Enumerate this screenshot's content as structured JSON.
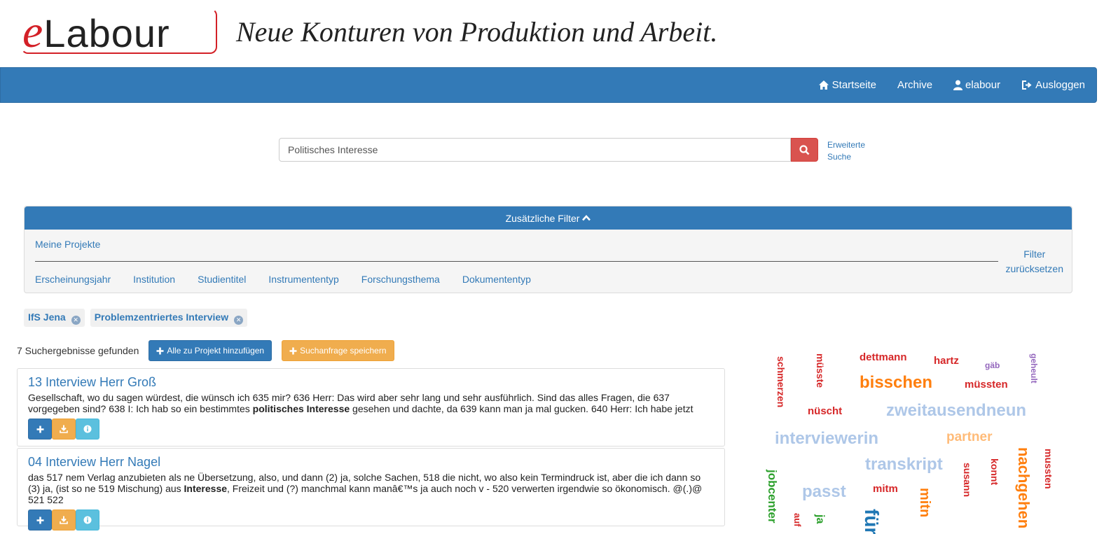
{
  "brand": {
    "logo_e": "e",
    "logo_rest": "Labour",
    "tagline": "Neue Konturen von Produktion und Arbeit."
  },
  "nav": {
    "home": {
      "label": "Startseite",
      "icon": "home-icon"
    },
    "archive": {
      "label": "Archive"
    },
    "user": {
      "label": "elabour",
      "icon": "user-icon"
    },
    "logout": {
      "label": "Ausloggen",
      "icon": "logout-icon"
    }
  },
  "search": {
    "value": "Politisches Interesse",
    "button_icon": "search-icon",
    "advanced_line1": "Erweiterte",
    "advanced_line2": "Suche"
  },
  "filters": {
    "header": "Zusätzliche Filter",
    "my_projects": "Meine Projekte",
    "tabs": [
      "Erscheinungsjahr",
      "Institution",
      "Studientitel",
      "Instrumententyp",
      "Forschungsthema",
      "Dokumententyp"
    ],
    "reset_line1": "Filter",
    "reset_line2": "zurücksetzen"
  },
  "chips": [
    "IfS Jena",
    "Problemzentriertes Interview"
  ],
  "results": {
    "count_text": "7 Suchergebnisse gefunden",
    "add_all": "Alle zu Projekt hinzufügen",
    "save_query": "Suchanfrage speichern",
    "items": [
      {
        "title": "13 Interview Herr Groß",
        "pre": "Gesellschaft, wo du sagen würdest, die wünsch ich 635 mir? 636 Herr: Das wird aber sehr lang und sehr ausführlich. Sind das alles Fragen, die 637 vorgegeben sind? 638 I: Ich hab so ein bestimmtes ",
        "highlight": "politisches Interesse",
        "post": " gesehen und dachte, da 639 kann man ja mal gucken. 640 Herr: Ich habe jetzt"
      },
      {
        "title": "04 Interview Herr Nagel",
        "pre": "das 517 nem Verlag anzubieten als ne Übersetzung, also, und dann (2) ja, solche Sachen, 518 die nicht, wo also kein Termindruck ist, aber die ich dann so (3) ja, (ist so ne 519 Mischung) aus ",
        "highlight": "Interesse",
        "post": ", Freizeit und (?) manchmal kann manâ€™s ja auch noch v - 520 verwerten irgendwie so ökonomisch. @(.)@ 521 522"
      }
    ]
  },
  "word_cloud": [
    {
      "text": "schmerzen",
      "color": "#d62728"
    },
    {
      "text": "müsste",
      "color": "#d62728"
    },
    {
      "text": "dettmann",
      "color": "#d62728"
    },
    {
      "text": "hartz",
      "color": "#d62728"
    },
    {
      "text": "gäb",
      "color": "#9467bd"
    },
    {
      "text": "geheult",
      "color": "#9467bd"
    },
    {
      "text": "bisschen",
      "color": "#ff7f0e"
    },
    {
      "text": "müssten",
      "color": "#d62728"
    },
    {
      "text": "nüscht",
      "color": "#d62728"
    },
    {
      "text": "zweitausendneun",
      "color": "#aec7e8"
    },
    {
      "text": "interviewerin",
      "color": "#aec7e8"
    },
    {
      "text": "partner",
      "color": "#ffbb78"
    },
    {
      "text": "transkript",
      "color": "#aec7e8"
    },
    {
      "text": "susann",
      "color": "#d62728"
    },
    {
      "text": "konnt",
      "color": "#d62728"
    },
    {
      "text": "nachgehen",
      "color": "#ff7f0e"
    },
    {
      "text": "mussten",
      "color": "#d62728"
    },
    {
      "text": "jobcenter",
      "color": "#2ca02c"
    },
    {
      "text": "passt",
      "color": "#aec7e8"
    },
    {
      "text": "mitm",
      "color": "#d62728"
    },
    {
      "text": "mitn",
      "color": "#ff7f0e"
    },
    {
      "text": "für",
      "color": "#1f77b4"
    },
    {
      "text": "ja",
      "color": "#2ca02c"
    },
    {
      "text": "auf",
      "color": "#d62728"
    }
  ]
}
